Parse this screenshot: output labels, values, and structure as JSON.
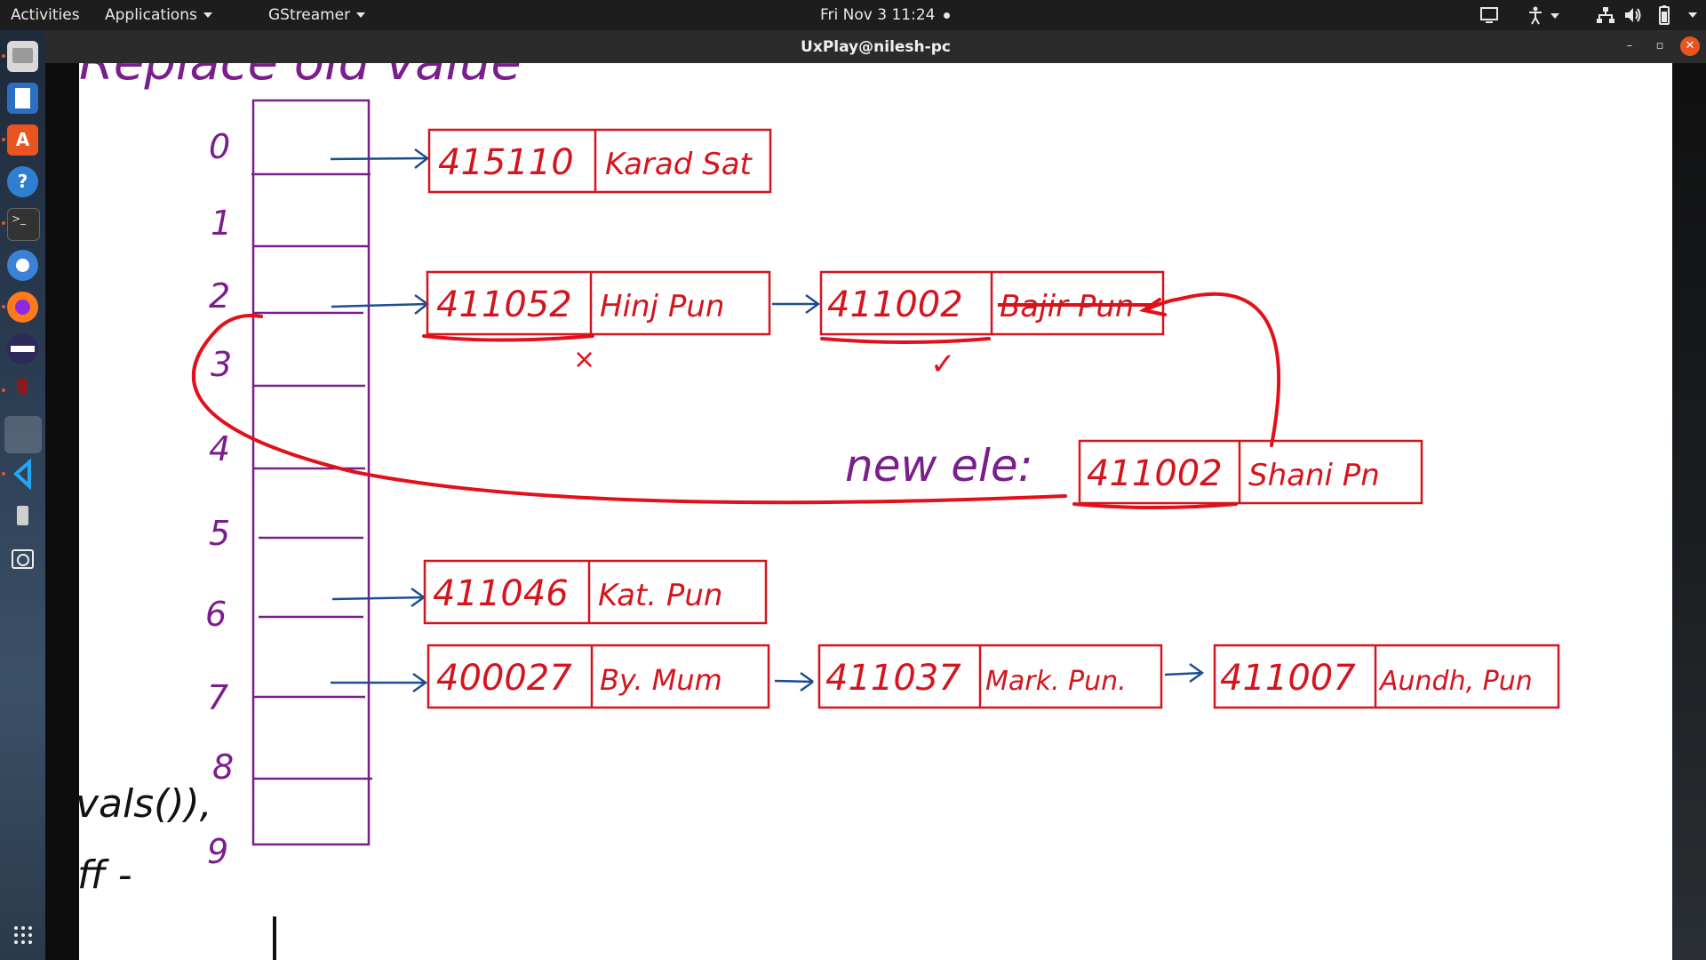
{
  "topbar": {
    "activities": "Activities",
    "applications": "Applications",
    "app_menu": "GStreamer",
    "clock": "Fri Nov 3  11:24"
  },
  "window": {
    "title": "UxPlay@nilesh-pc"
  },
  "dock": {
    "items": [
      "files-icon",
      "writer-icon",
      "software-icon",
      "help-icon",
      "terminal-icon",
      "chromium-icon",
      "firefox-icon",
      "eclipse-icon",
      "wine-icon",
      "blank-app-icon",
      "vscode-icon",
      "usb-drive-icon",
      "screenshot-icon"
    ],
    "show_apps": "show-apps-icon"
  },
  "whiteboard": {
    "heading_fragment": "Replace old value",
    "indices": [
      "0",
      "1",
      "2",
      "3",
      "4",
      "5",
      "6",
      "7",
      "8",
      "9"
    ],
    "nodes": {
      "row0": [
        {
          "pin": "415110",
          "city": "Karad Sat"
        }
      ],
      "row2": [
        {
          "pin": "411052",
          "city": "Hinj Pun"
        },
        {
          "pin": "411002",
          "city": "Bajir Pun"
        }
      ],
      "row6": [
        {
          "pin": "411046",
          "city": "Kat. Pun"
        }
      ],
      "row7": [
        {
          "pin": "400027",
          "city": "By. Mum"
        },
        {
          "pin": "411037",
          "city": "Mark. Pun."
        },
        {
          "pin": "411007",
          "city": "Aundh, Pun"
        }
      ]
    },
    "new_element": {
      "label": "new ele:",
      "pin": "411002",
      "city": "Shani Pn"
    },
    "marks": {
      "cross": "×",
      "check": "✓"
    },
    "left_fragments": [
      "vals()),",
      "ff -"
    ]
  },
  "colors": {
    "purple": "#7a1e8c",
    "red": "#d4151e",
    "blue": "#1d4e8f",
    "accent": "#e95420"
  }
}
